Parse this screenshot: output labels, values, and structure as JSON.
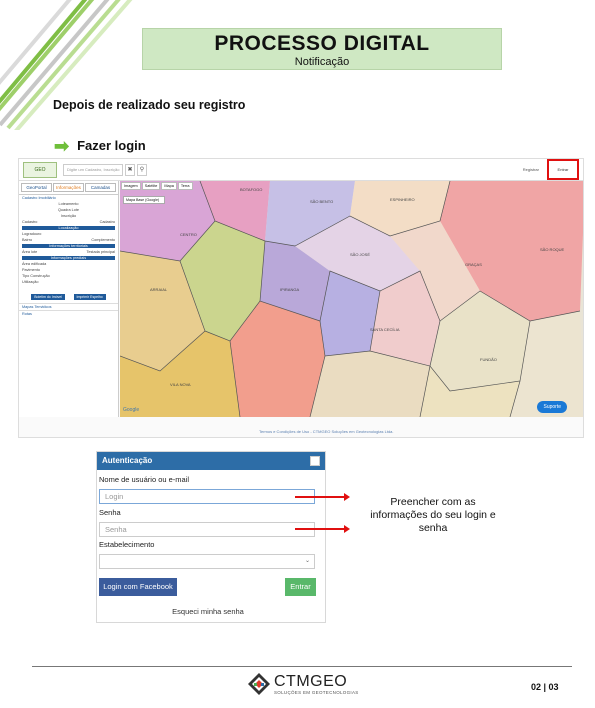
{
  "header": {
    "title": "PROCESSO DIGITAL",
    "subtitle": "Notificação"
  },
  "intro": "Depois de realizado seu registro",
  "step": {
    "label": "Fazer login"
  },
  "screenshot": {
    "search_placeholder": "Digite um Cadastro, Inscrição",
    "register_text": "Registrar",
    "login_text": "Entrar",
    "sidebar_tabs": [
      "GeoPortal",
      "Informações",
      "Camadas"
    ],
    "sidebar_section": "Cadastro Imobiliário",
    "sidebar_lines": [
      "Loteamento",
      "Quadra Lote",
      "Inscrição",
      "Cadastro",
      "Cadastro"
    ],
    "sidebar_heads": [
      "Localização",
      "Informações territoriais",
      "Informações prediais"
    ],
    "sidebar_fields": [
      "Logradouro",
      "Bairro",
      "Complemento",
      "Área lote",
      "Testada principal",
      "Área edificada",
      "Pavimento",
      "Tipo Construção",
      "Utilização"
    ],
    "sidebar_buttons": [
      "Boletim do Imóvel",
      "Imprimir Espelho"
    ],
    "sidebar_collapsed": [
      "Mapas Temáticos",
      "Rotas"
    ],
    "map_tabs": [
      "Imagem",
      "Satélite",
      "Mapa",
      "Terra"
    ],
    "map_select": "Mapa Base (Google)",
    "support_button": "Suporte",
    "google_label": "Google",
    "footer_link": "Termos e Condições de Uso - CTMGEO Soluções em Geotecnologias Ltda.",
    "map_labels": [
      "BOTAFOGO",
      "SÃO JOSÉ",
      "CENTRO",
      "ARRAIAL",
      "SANTA CECÍLIA",
      "IPIRANGA",
      "SÃO BENTO",
      "VILA NOVA",
      "ESPINHEIRO",
      "GRAÇAS",
      "FUNDÃO",
      "SÃO ROQUE"
    ]
  },
  "login_form": {
    "title": "Autenticação",
    "user_label": "Nome de usuário ou e-mail",
    "user_placeholder": "Login",
    "password_label": "Senha",
    "password_placeholder": "Senha",
    "establishment_label": "Estabelecimento",
    "facebook_button": "Login com Facebook",
    "submit_button": "Entrar",
    "forgot_link": "Esqueci minha senha"
  },
  "note": "Preencher com as informações do seu login e senha",
  "footer": {
    "company": "CTMGEO",
    "tagline": "SOLUÇÕES EM GEOTECNOLOGIAS",
    "page": "02 | 03"
  },
  "colors": {
    "title_bg": "#cfe8c3",
    "brand_blue": "#2d6da7",
    "highlight_red": "#e01010",
    "accent_green": "#6fbf3a"
  }
}
